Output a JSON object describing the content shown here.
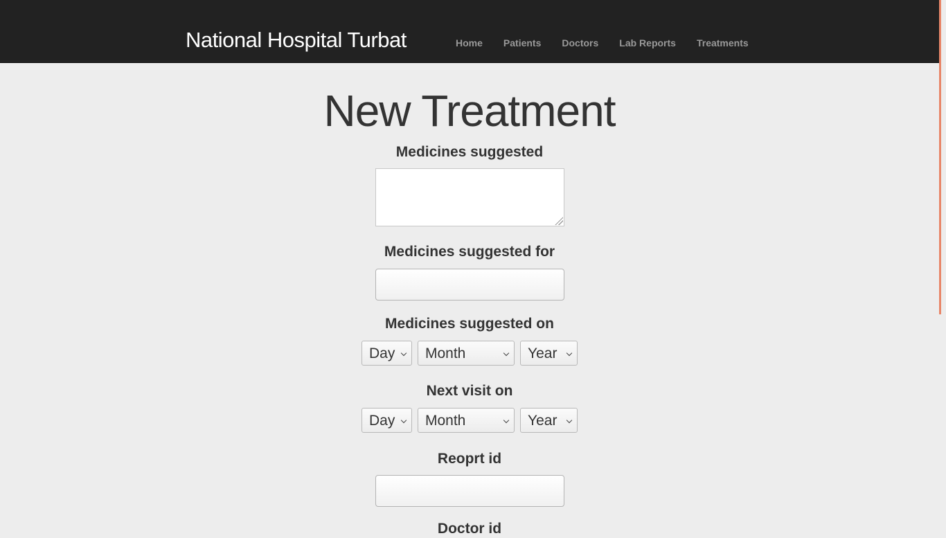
{
  "navbar": {
    "brand": "National Hospital Turbat",
    "links": [
      "Home",
      "Patients",
      "Doctors",
      "Lab Reports",
      "Treatments"
    ]
  },
  "form": {
    "title": "New Treatment",
    "medicines_suggested_label": "Medicines suggested",
    "medicines_suggested_value": "",
    "medicines_suggested_for_label": "Medicines suggested for",
    "medicines_suggested_for_value": "",
    "medicines_suggested_on_label": "Medicines suggested on",
    "next_visit_on_label": "Next visit on",
    "date_selects": {
      "day": "Day",
      "month": "Month",
      "year": "Year"
    },
    "report_id_label": "Reoprt id",
    "report_id_value": "",
    "doctor_id_label": "Doctor id"
  },
  "colors": {
    "navbar_bg": "#222222",
    "page_bg": "#ededed",
    "scroll_accent": "#e8876a"
  }
}
